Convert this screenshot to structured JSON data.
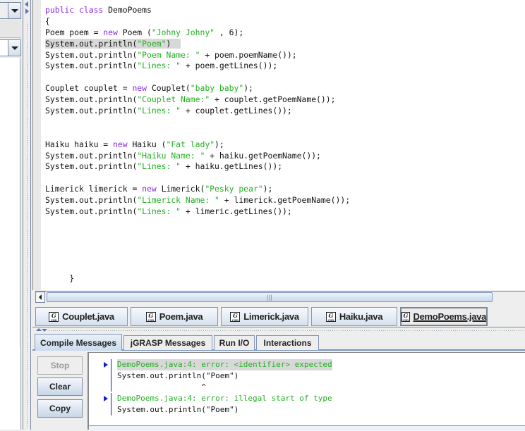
{
  "editor": {
    "lines": [
      [
        {
          "t": "public class DemoPoems",
          "c": "kw-start"
        }
      ],
      [
        {
          "t": "{",
          "c": ""
        }
      ],
      [
        {
          "t": "Poem poem = ",
          "c": ""
        },
        {
          "t": "new",
          "c": "kw"
        },
        {
          "t": " Poem (",
          "c": ""
        },
        {
          "t": "\"Johny Johny\"",
          "c": "str"
        },
        {
          "t": " , 6);",
          "c": ""
        }
      ],
      [
        {
          "t": "System.out.println(",
          "c": "hl"
        },
        {
          "t": "\"Poem\"",
          "c": "str hl"
        },
        {
          "t": ")  ",
          "c": "hl"
        }
      ],
      [
        {
          "t": "System.out.println(",
          "c": ""
        },
        {
          "t": "\"Poem Name: \"",
          "c": "str"
        },
        {
          "t": " + poem.poemName());",
          "c": ""
        }
      ],
      [
        {
          "t": "System.out.println(",
          "c": ""
        },
        {
          "t": "\"Lines: \"",
          "c": "str"
        },
        {
          "t": " + poem.getLines());",
          "c": ""
        }
      ],
      [
        {
          "t": "",
          "c": ""
        }
      ],
      [
        {
          "t": "Couplet couplet = ",
          "c": ""
        },
        {
          "t": "new",
          "c": "kw"
        },
        {
          "t": " Couplet(",
          "c": ""
        },
        {
          "t": "\"baby baby\"",
          "c": "str"
        },
        {
          "t": ");",
          "c": ""
        }
      ],
      [
        {
          "t": "System.out.println(",
          "c": ""
        },
        {
          "t": "\"Couplet Name:\"",
          "c": "str"
        },
        {
          "t": " + couplet.getPoemName());",
          "c": ""
        }
      ],
      [
        {
          "t": "System.out.println(",
          "c": ""
        },
        {
          "t": "\"Lines: \"",
          "c": "str"
        },
        {
          "t": " + couplet.getLines());",
          "c": ""
        }
      ],
      [
        {
          "t": "",
          "c": ""
        }
      ],
      [
        {
          "t": "",
          "c": ""
        }
      ],
      [
        {
          "t": "Haiku haiku = ",
          "c": ""
        },
        {
          "t": "new",
          "c": "kw"
        },
        {
          "t": " Haiku (",
          "c": ""
        },
        {
          "t": "\"Fat lady\"",
          "c": "str"
        },
        {
          "t": ");",
          "c": ""
        }
      ],
      [
        {
          "t": "System.out.println(",
          "c": ""
        },
        {
          "t": "\"Haiku Name: \"",
          "c": "str"
        },
        {
          "t": " + haiku.getPoemName());",
          "c": ""
        }
      ],
      [
        {
          "t": "System.out.println(",
          "c": ""
        },
        {
          "t": "\"Lines: \"",
          "c": "str"
        },
        {
          "t": " + haiku.getLines());",
          "c": ""
        }
      ],
      [
        {
          "t": "",
          "c": ""
        }
      ],
      [
        {
          "t": "Limerick limerick = ",
          "c": ""
        },
        {
          "t": "new",
          "c": "kw"
        },
        {
          "t": " Limerick(",
          "c": ""
        },
        {
          "t": "\"Pesky pear\"",
          "c": "str"
        },
        {
          "t": ");",
          "c": ""
        }
      ],
      [
        {
          "t": "System.out.println(",
          "c": ""
        },
        {
          "t": "\"Limerick Name: \"",
          "c": "str"
        },
        {
          "t": " + limerick.getPoemName());",
          "c": ""
        }
      ],
      [
        {
          "t": "System.out.println(",
          "c": ""
        },
        {
          "t": "\"Lines: \"",
          "c": "str"
        },
        {
          "t": " + limeric.getLines());",
          "c": ""
        }
      ],
      [
        {
          "t": "",
          "c": ""
        }
      ],
      [
        {
          "t": "",
          "c": ""
        }
      ],
      [
        {
          "t": "",
          "c": ""
        }
      ],
      [
        {
          "t": "",
          "c": ""
        }
      ],
      [
        {
          "t": "",
          "c": ""
        }
      ],
      [
        {
          "t": "     }",
          "c": ""
        }
      ]
    ]
  },
  "file_tabs": [
    {
      "label": "Couplet.java",
      "active": false
    },
    {
      "label": "Poem.java",
      "active": false
    },
    {
      "label": "Limerick.java",
      "active": false
    },
    {
      "label": "Haiku.java",
      "active": false
    },
    {
      "label": "DemoPoems.java",
      "active": true
    }
  ],
  "file_icon": {
    "letter": "G",
    "sub": "CSD"
  },
  "message_tabs": [
    {
      "label": "Compile Messages",
      "active": true
    },
    {
      "label": "jGRASP Messages",
      "active": false
    },
    {
      "label": "Run I/O",
      "active": false
    },
    {
      "label": "Interactions",
      "active": false
    }
  ],
  "buttons": {
    "stop": "Stop",
    "clear": "Clear",
    "copy": "Copy"
  },
  "messages": [
    {
      "error": "DemoPoems.java:4: error: <identifier> expected",
      "source": "System.out.println(\"Poem\")",
      "caret": "                  ^",
      "highlighted": true
    },
    {
      "error": "DemoPoems.java:4: error: illegal start of type",
      "source": "System.out.println(\"Poem\")",
      "caret": null,
      "highlighted": false
    }
  ],
  "scroll_thumb_grip": "|||",
  "colors": {
    "keyword": "#8a2be2",
    "string": "#22b022",
    "error_marker": "#1122cc",
    "highlight": "#d8d8d8"
  }
}
